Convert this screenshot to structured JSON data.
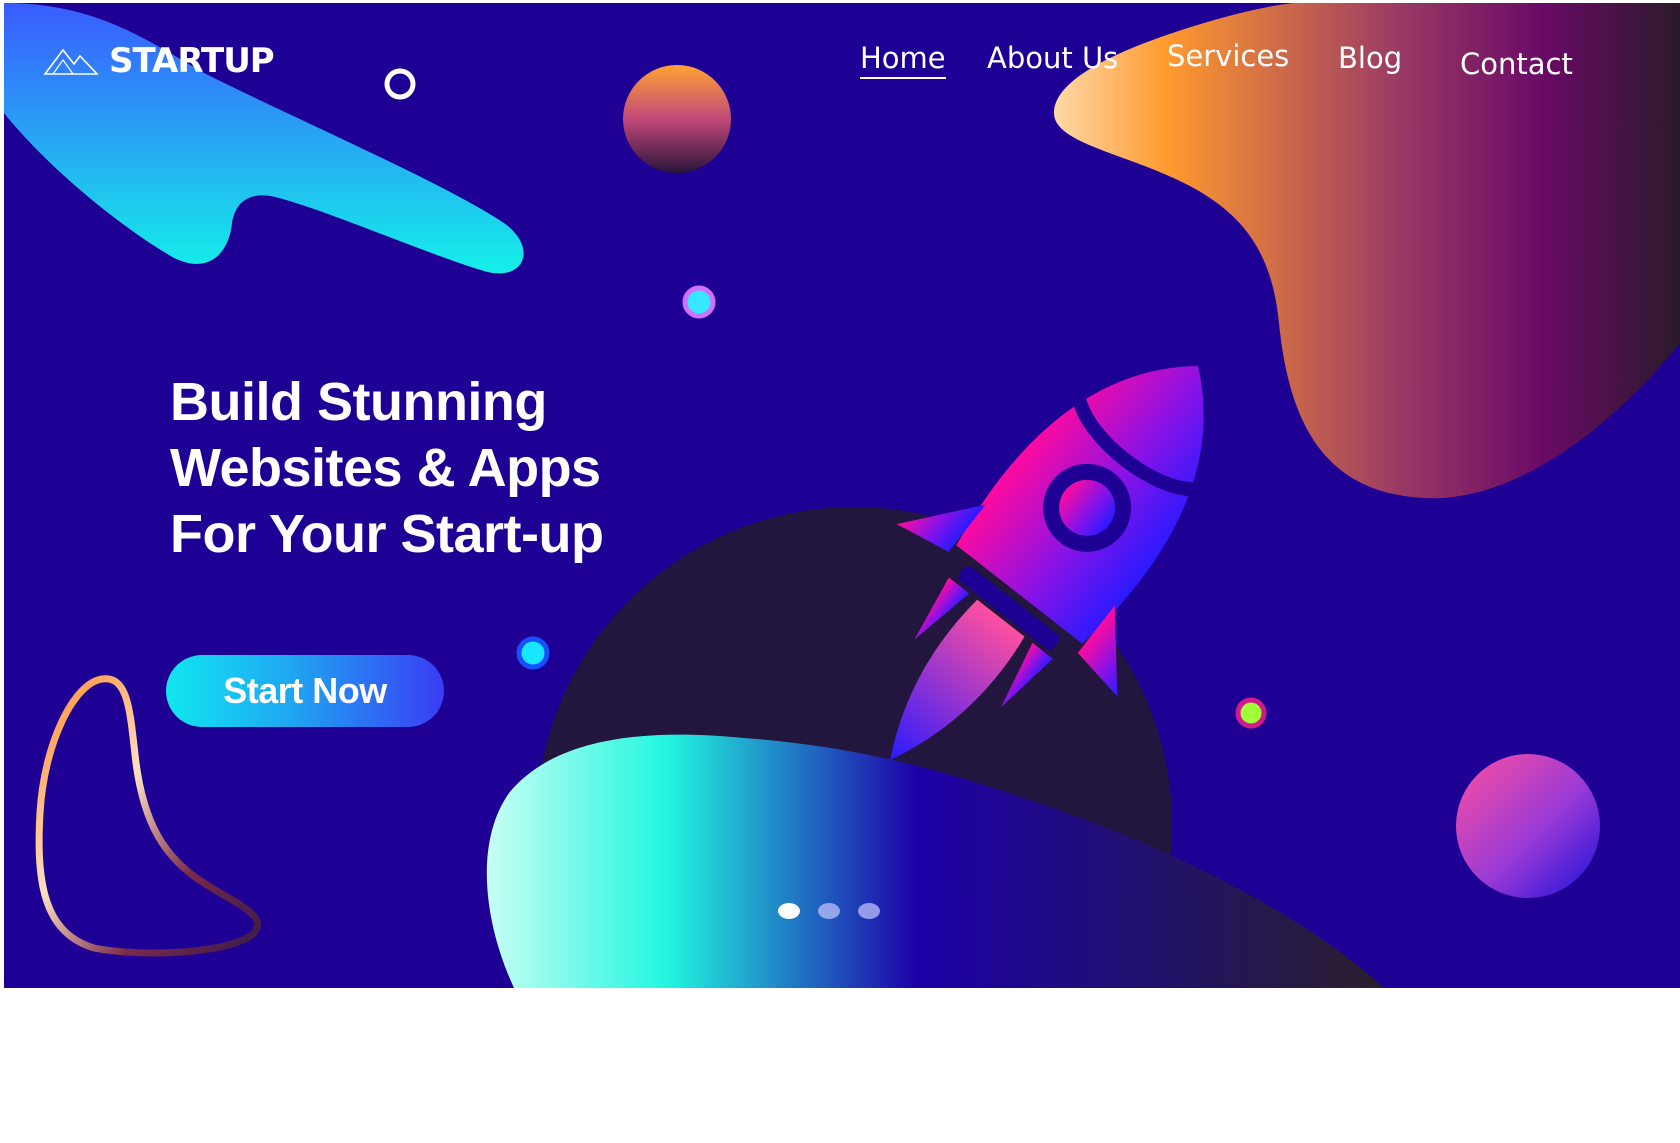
{
  "brand": {
    "name": "STARTUP",
    "logo_icon": "mountain-icon"
  },
  "nav": {
    "items": [
      {
        "label": "Home",
        "active": true
      },
      {
        "label": "About Us",
        "active": false
      },
      {
        "label": "Services",
        "active": false
      },
      {
        "label": "Blog",
        "active": false
      },
      {
        "label": "Contact",
        "active": false
      }
    ]
  },
  "hero": {
    "headline": [
      "Build Stunning",
      "Websites & Apps",
      "For Your Start-up"
    ],
    "cta_label": "Start Now",
    "illustration": "rocket-icon"
  },
  "carousel": {
    "count": 3,
    "active_index": 0
  },
  "colors": {
    "background": "#1e0095",
    "accent_cyan": "#12e6f0",
    "accent_orange": "#ff9a2e",
    "accent_magenta": "#ff0aa0",
    "accent_purple": "#8a12e6"
  }
}
